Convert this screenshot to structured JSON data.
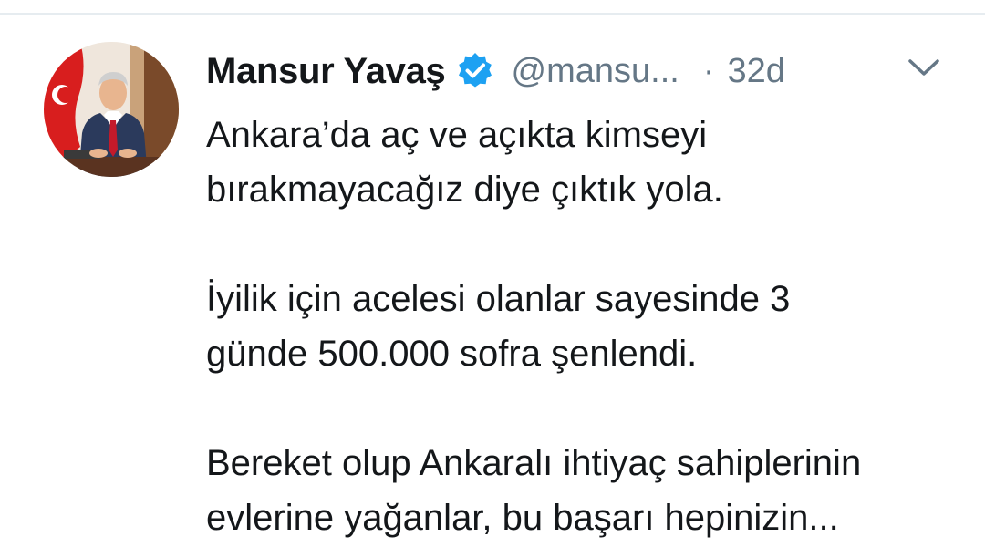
{
  "tweet": {
    "author": {
      "name": "Mansur Yavaş",
      "handle": "@mansu...",
      "verified": true
    },
    "separator": "·",
    "time_ago": "32d",
    "paragraphs": [
      [
        "Ankara’da aç ve açıkta kimseyi",
        "bırakmayacağız diye çıktık yola."
      ],
      [
        "İyilik için acelesi olanlar sayesinde 3",
        "günde 500.000 sofra şenlendi."
      ],
      [
        "Bereket olup Ankaralı ihtiyaç sahiplerinin",
        "evlerine yağanlar, bu başarı hepinizin..."
      ]
    ]
  },
  "icons": {
    "verified": "verified-badge-icon",
    "menu": "chevron-down-icon"
  },
  "colors": {
    "verified_blue": "#1da1f2",
    "text_primary": "#14171a",
    "text_secondary": "#657786",
    "divider": "#e6ecf0"
  }
}
